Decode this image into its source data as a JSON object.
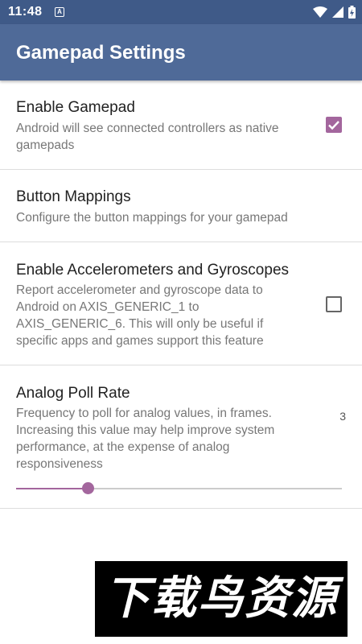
{
  "status_bar": {
    "time": "11:48",
    "notification_icon": "A",
    "icons": [
      "wifi-icon",
      "signal-icon",
      "battery-charging-icon"
    ]
  },
  "app_bar": {
    "title": "Gamepad Settings"
  },
  "preferences": [
    {
      "title": "Enable Gamepad",
      "summary": "Android will see connected controllers as native gamepads",
      "checked": true
    },
    {
      "title": "Button Mappings",
      "summary": "Configure the button mappings for your gamepad"
    },
    {
      "title": "Enable Accelerometers and Gyroscopes",
      "summary": "Report accelerometer and gyroscope data to Android on AXIS_GENERIC_1 to AXIS_GENERIC_6. This will only be useful if specific apps and games support this feature",
      "checked": false
    },
    {
      "title": "Analog Poll Rate",
      "summary": "Frequency to poll for analog values, in frames. Increasing this value may help improve system performance, at the expense of analog responsiveness",
      "value": "3",
      "slider_fraction": 0.22
    }
  ],
  "watermark": {
    "text": "下载鸟资源"
  },
  "colors": {
    "status_bar": "#3f5a88",
    "app_bar": "#4f6a98",
    "accent": "#a3669d"
  }
}
